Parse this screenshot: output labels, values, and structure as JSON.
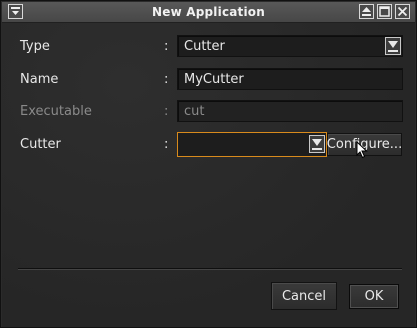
{
  "window": {
    "title": "New Application",
    "menu_icon": "window-menu-icon",
    "controls": [
      "shade-icon",
      "maximize-icon",
      "close-icon"
    ]
  },
  "form": {
    "separator": ":",
    "type": {
      "label": "Type",
      "value": "Cutter"
    },
    "name": {
      "label": "Name",
      "value": "MyCutter"
    },
    "executable": {
      "label": "Executable",
      "value": "cut"
    },
    "cutter": {
      "label": "Cutter",
      "value": "",
      "configure_label": "Configure..."
    }
  },
  "buttons": {
    "cancel": "Cancel",
    "ok": "OK"
  },
  "colors": {
    "focus_border": "#d88a1c",
    "background": "#2b2b2b"
  }
}
